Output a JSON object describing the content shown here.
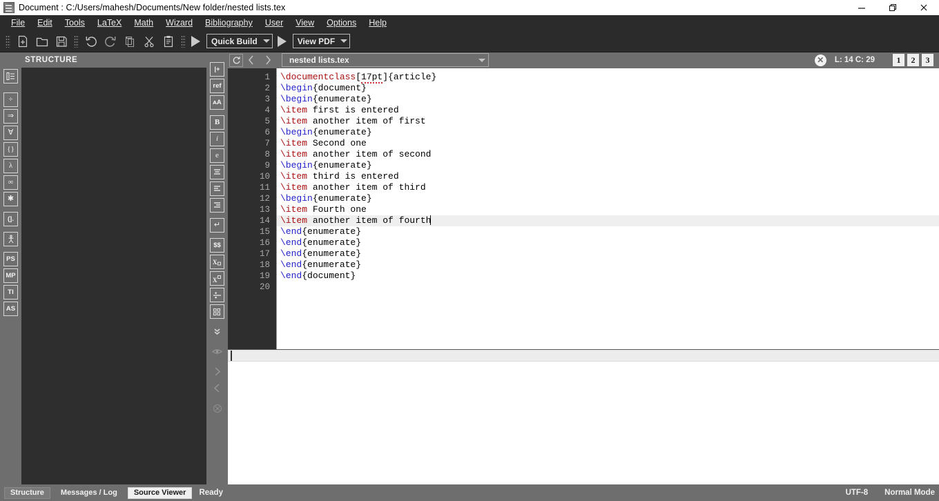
{
  "window": {
    "title": "Document : C:/Users/mahesh/Documents/New folder/nested lists.tex",
    "app_icon": "document-icon",
    "minimize_label": "—",
    "restore_label": "❐",
    "close_label": "✕"
  },
  "menubar": {
    "items": [
      {
        "label": "File",
        "mnemonic": "F"
      },
      {
        "label": "Edit",
        "mnemonic": "E"
      },
      {
        "label": "Tools",
        "mnemonic": "T"
      },
      {
        "label": "LaTeX",
        "mnemonic": "L"
      },
      {
        "label": "Math",
        "mnemonic": "M"
      },
      {
        "label": "Wizard",
        "mnemonic": "W"
      },
      {
        "label": "Bibliography",
        "mnemonic": "B"
      },
      {
        "label": "User",
        "mnemonic": "U"
      },
      {
        "label": "View",
        "mnemonic": "V"
      },
      {
        "label": "Options",
        "mnemonic": "O"
      },
      {
        "label": "Help",
        "mnemonic": "H"
      }
    ]
  },
  "toolbar": {
    "buttons": [
      {
        "name": "new-file-icon",
        "tip": "New"
      },
      {
        "name": "open-folder-icon",
        "tip": "Open"
      },
      {
        "name": "save-icon",
        "tip": "Save"
      },
      {
        "name": "undo-icon",
        "tip": "Undo"
      },
      {
        "name": "redo-icon",
        "tip": "Redo"
      },
      {
        "name": "copy-icon",
        "tip": "Copy"
      },
      {
        "name": "cut-scissors-icon",
        "tip": "Cut"
      },
      {
        "name": "paste-clipboard-icon",
        "tip": "Paste"
      }
    ],
    "build_label": "Quick Build",
    "view_label": "View PDF",
    "run_build_icon": "play-triangle-icon",
    "run_view_icon": "play-triangle-icon"
  },
  "structure_panel": {
    "title": "STRUCTURE"
  },
  "document_bar": {
    "refresh_icon": "refresh-icon",
    "back_icon": "chevron-left-icon",
    "forward_icon": "chevron-right-icon",
    "file_name": "nested lists.tex",
    "close_label": "✕",
    "position": "L: 14 C: 29",
    "view_buttons": [
      "1",
      "2",
      "3"
    ]
  },
  "left_tools": [
    {
      "name": "structure-list-icon",
      "glyph": "≣",
      "boxed": true
    },
    {
      "name": "division-icon",
      "glyph": "÷",
      "boxed": true
    },
    {
      "name": "implies-arrow-icon",
      "glyph": "⇒",
      "boxed": true
    },
    {
      "name": "forall-icon",
      "glyph": "∀",
      "boxed": true
    },
    {
      "name": "braces-icon",
      "glyph": "{}",
      "boxed": true
    },
    {
      "name": "lambda-icon",
      "glyph": "λ",
      "boxed": true
    },
    {
      "name": "infinity-icon",
      "glyph": "∞",
      "boxed": true
    },
    {
      "name": "asterisk-operator-icon",
      "glyph": "✱",
      "boxed": true
    },
    {
      "name": "delimiter-icon",
      "glyph": "(].",
      "boxed": true
    },
    {
      "name": "stick-figure-icon",
      "glyph": "人",
      "boxed": true
    },
    {
      "name": "postscript-icon",
      "glyph": "PS",
      "boxed": true
    },
    {
      "name": "metapost-icon",
      "glyph": "MP",
      "boxed": true
    },
    {
      "name": "tikz-icon",
      "glyph": "TI",
      "boxed": true
    },
    {
      "name": "asymptote-icon",
      "glyph": "AS",
      "boxed": true
    }
  ],
  "mid_tools": [
    {
      "name": "insert-bar-icon",
      "glyph": "|+",
      "boxed": true
    },
    {
      "name": "reference-icon",
      "glyph": "ref",
      "boxed": true
    },
    {
      "name": "font-size-icon",
      "glyph": "ᴀA",
      "boxed": true
    },
    {
      "name": "bold-icon",
      "glyph": "B",
      "boxed": true
    },
    {
      "name": "italic-icon",
      "glyph": "i",
      "boxed": true
    },
    {
      "name": "emphasis-icon",
      "glyph": "e",
      "boxed": true
    },
    {
      "name": "align-center-icon",
      "glyph": "≡",
      "boxed": true
    },
    {
      "name": "align-left-icon",
      "glyph": "≡",
      "boxed": true
    },
    {
      "name": "align-right-icon",
      "glyph": "≡",
      "boxed": true
    },
    {
      "name": "newline-icon",
      "glyph": "↵",
      "boxed": true
    },
    {
      "name": "display-math-icon",
      "glyph": "$$",
      "boxed": true
    },
    {
      "name": "subscript-icon",
      "glyph": "X▫",
      "boxed": true
    },
    {
      "name": "superscript-icon",
      "glyph": "X▫",
      "boxed": true
    },
    {
      "name": "fraction-icon",
      "glyph": "÷",
      "boxed": true
    },
    {
      "name": "matrix-icon",
      "glyph": "▦",
      "boxed": true
    },
    {
      "name": "expand-down-icon",
      "glyph": "˅˅",
      "boxed": false
    },
    {
      "name": "preview-eye-icon",
      "glyph": "◉",
      "boxed": false
    },
    {
      "name": "next-icon",
      "glyph": "›",
      "boxed": false
    },
    {
      "name": "previous-icon",
      "glyph": "‹",
      "boxed": false
    },
    {
      "name": "cancel-icon",
      "glyph": "⊗",
      "boxed": false
    }
  ],
  "editor": {
    "language": "latex",
    "current_line": 14,
    "cursor_column": 29,
    "line_count": 20,
    "lines": [
      {
        "n": 1,
        "tokens": [
          {
            "t": "\\documentclass",
            "c": "cmd"
          },
          {
            "t": "[",
            "c": "txt"
          },
          {
            "t": "17pt",
            "c": "opt"
          },
          {
            "t": "]{article}",
            "c": "txt"
          }
        ]
      },
      {
        "n": 2,
        "tokens": [
          {
            "t": "\\begin",
            "c": "env"
          },
          {
            "t": "{document}",
            "c": "txt"
          }
        ]
      },
      {
        "n": 3,
        "tokens": [
          {
            "t": "\\begin",
            "c": "env"
          },
          {
            "t": "{enumerate}",
            "c": "txt"
          }
        ]
      },
      {
        "n": 4,
        "tokens": [
          {
            "t": "\\item",
            "c": "cmd"
          },
          {
            "t": " first is entered",
            "c": "txt"
          }
        ]
      },
      {
        "n": 5,
        "tokens": [
          {
            "t": "\\item",
            "c": "cmd"
          },
          {
            "t": " another item of first",
            "c": "txt"
          }
        ]
      },
      {
        "n": 6,
        "tokens": [
          {
            "t": "\\begin",
            "c": "env"
          },
          {
            "t": "{enumerate}",
            "c": "txt"
          }
        ]
      },
      {
        "n": 7,
        "tokens": [
          {
            "t": "\\item",
            "c": "cmd"
          },
          {
            "t": " Second one",
            "c": "txt"
          }
        ]
      },
      {
        "n": 8,
        "tokens": [
          {
            "t": "\\item",
            "c": "cmd"
          },
          {
            "t": " another item of second",
            "c": "txt"
          }
        ]
      },
      {
        "n": 9,
        "tokens": [
          {
            "t": "\\begin",
            "c": "env"
          },
          {
            "t": "{enumerate}",
            "c": "txt"
          }
        ]
      },
      {
        "n": 10,
        "tokens": [
          {
            "t": "\\item",
            "c": "cmd"
          },
          {
            "t": " third is entered",
            "c": "txt"
          }
        ]
      },
      {
        "n": 11,
        "tokens": [
          {
            "t": "\\item",
            "c": "cmd"
          },
          {
            "t": " another item of third",
            "c": "txt"
          }
        ]
      },
      {
        "n": 12,
        "tokens": [
          {
            "t": "\\begin",
            "c": "env"
          },
          {
            "t": "{enumerate}",
            "c": "txt"
          }
        ]
      },
      {
        "n": 13,
        "tokens": [
          {
            "t": "\\item",
            "c": "cmd"
          },
          {
            "t": " Fourth one",
            "c": "txt"
          }
        ]
      },
      {
        "n": 14,
        "tokens": [
          {
            "t": "\\item",
            "c": "cmd"
          },
          {
            "t": " another item of fourth",
            "c": "txt"
          }
        ],
        "cursor": true
      },
      {
        "n": 15,
        "tokens": [
          {
            "t": "\\end",
            "c": "env"
          },
          {
            "t": "{enumerate}",
            "c": "txt"
          }
        ]
      },
      {
        "n": 16,
        "tokens": [
          {
            "t": "\\end",
            "c": "env"
          },
          {
            "t": "{enumerate}",
            "c": "txt"
          }
        ]
      },
      {
        "n": 17,
        "tokens": [
          {
            "t": "\\end",
            "c": "env"
          },
          {
            "t": "{enumerate}",
            "c": "txt"
          }
        ]
      },
      {
        "n": 18,
        "tokens": [
          {
            "t": "\\end",
            "c": "env"
          },
          {
            "t": "{enumerate}",
            "c": "txt"
          }
        ]
      },
      {
        "n": 19,
        "tokens": [
          {
            "t": "\\end",
            "c": "env"
          },
          {
            "t": "{document}",
            "c": "txt"
          }
        ]
      },
      {
        "n": 20,
        "tokens": []
      }
    ]
  },
  "statusbar": {
    "tabs": [
      {
        "label": "Structure",
        "active": false,
        "framed": true
      },
      {
        "label": "Messages / Log",
        "active": false,
        "framed": false
      },
      {
        "label": "Source Viewer",
        "active": true,
        "framed": false
      }
    ],
    "status": "Ready",
    "encoding": "UTF-8",
    "mode": "Normal Mode"
  },
  "colors": {
    "chrome": "#6e6e6e",
    "toolbar": "#2b2b2b",
    "panel_dark": "#2e2e2e",
    "editor_bg": "#ffffff",
    "command": "#aa1111",
    "environment": "#2222cc",
    "error_underline": "#d03030",
    "current_line": "#efefef"
  }
}
